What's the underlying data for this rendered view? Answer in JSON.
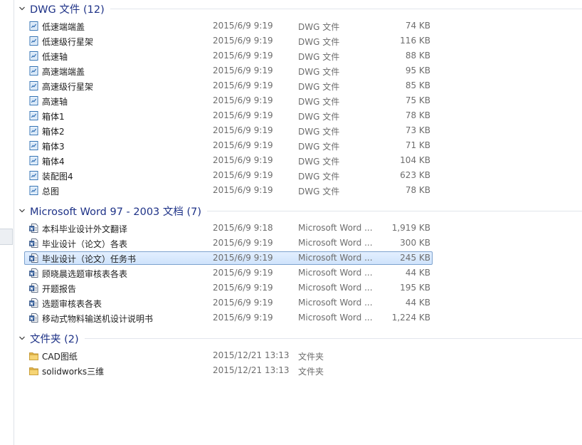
{
  "groups": [
    {
      "title": "DWG 文件 (12)",
      "icon": "dwg-file-icon",
      "items": [
        {
          "name": "低速端端盖",
          "date": "2015/6/9 9:19",
          "type": "DWG 文件",
          "size": "74 KB"
        },
        {
          "name": "低速级行星架",
          "date": "2015/6/9 9:19",
          "type": "DWG 文件",
          "size": "116 KB"
        },
        {
          "name": "低速轴",
          "date": "2015/6/9 9:19",
          "type": "DWG 文件",
          "size": "88 KB"
        },
        {
          "name": "高速端端盖",
          "date": "2015/6/9 9:19",
          "type": "DWG 文件",
          "size": "95 KB"
        },
        {
          "name": "高速级行星架",
          "date": "2015/6/9 9:19",
          "type": "DWG 文件",
          "size": "85 KB"
        },
        {
          "name": "高速轴",
          "date": "2015/6/9 9:19",
          "type": "DWG 文件",
          "size": "75 KB"
        },
        {
          "name": "箱体1",
          "date": "2015/6/9 9:19",
          "type": "DWG 文件",
          "size": "78 KB"
        },
        {
          "name": "箱体2",
          "date": "2015/6/9 9:19",
          "type": "DWG 文件",
          "size": "73 KB"
        },
        {
          "name": "箱体3",
          "date": "2015/6/9 9:19",
          "type": "DWG 文件",
          "size": "71 KB"
        },
        {
          "name": "箱体4",
          "date": "2015/6/9 9:19",
          "type": "DWG 文件",
          "size": "104 KB"
        },
        {
          "name": "装配图4",
          "date": "2015/6/9 9:19",
          "type": "DWG 文件",
          "size": "623 KB"
        },
        {
          "name": "总图",
          "date": "2015/6/9 9:19",
          "type": "DWG 文件",
          "size": "78 KB"
        }
      ]
    },
    {
      "title": "Microsoft Word 97 - 2003 文档 (7)",
      "icon": "word-document-icon",
      "items": [
        {
          "name": "本科毕业设计外文翻译",
          "date": "2015/6/9 9:18",
          "type": "Microsoft Word ...",
          "size": "1,919 KB"
        },
        {
          "name": "毕业设计（论文）各表",
          "date": "2015/6/9 9:19",
          "type": "Microsoft Word ...",
          "size": "300 KB"
        },
        {
          "name": "毕业设计（论文）任务书",
          "date": "2015/6/9 9:19",
          "type": "Microsoft Word ...",
          "size": "245 KB"
        },
        {
          "name": "顾晓晨选题审核表各表",
          "date": "2015/6/9 9:19",
          "type": "Microsoft Word ...",
          "size": "44 KB"
        },
        {
          "name": "开题报告",
          "date": "2015/6/9 9:19",
          "type": "Microsoft Word ...",
          "size": "195 KB"
        },
        {
          "name": "选题审核表各表",
          "date": "2015/6/9 9:19",
          "type": "Microsoft Word ...",
          "size": "44 KB"
        },
        {
          "name": "移动式物料输送机设计说明书",
          "date": "2015/6/9 9:19",
          "type": "Microsoft Word ...",
          "size": "1,224 KB"
        }
      ]
    },
    {
      "title": "文件夹 (2)",
      "icon": "folder-icon",
      "items": [
        {
          "name": "CAD图纸",
          "date": "2015/12/21 13:13",
          "type": "文件夹",
          "size": ""
        },
        {
          "name": "solidworks三维",
          "date": "2015/12/21 13:13",
          "type": "文件夹",
          "size": ""
        }
      ]
    }
  ],
  "selected": "毕业设计（论文）任务书",
  "colors": {
    "group_title": "#1e3287",
    "selection_border": "#7da2ce",
    "selection_fill": "#dceaff",
    "secondary_text": "#6d6d6d"
  }
}
